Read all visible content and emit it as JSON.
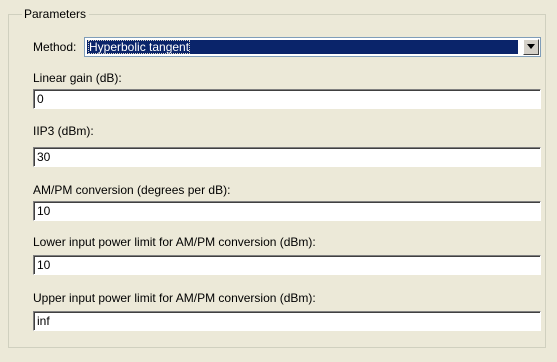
{
  "groupbox": {
    "legend": "Parameters"
  },
  "method": {
    "label": "Method:",
    "selected": "Hyperbolic tangent",
    "dropdown_icon": "chevron-down-icon"
  },
  "fields": [
    {
      "label": "Linear gain (dB):",
      "value": "0"
    },
    {
      "label": "IIP3 (dBm):",
      "value": "30"
    },
    {
      "label": "AM/PM conversion (degrees per dB):",
      "value": "10"
    },
    {
      "label": "Lower input power limit for AM/PM conversion (dBm):",
      "value": "10"
    },
    {
      "label": "Upper input power limit for AM/PM conversion (dBm):",
      "value": "inf"
    }
  ]
}
